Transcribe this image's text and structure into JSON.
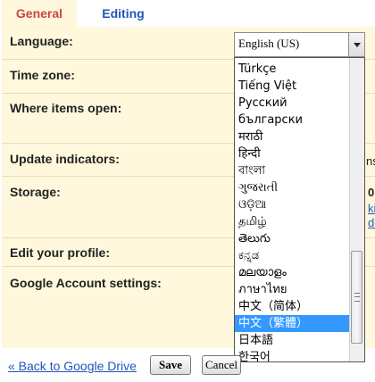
{
  "tabs": {
    "general": "General",
    "editing": "Editing"
  },
  "settings": {
    "language_label": "Language:",
    "time_zone_label": "Time zone:",
    "where_items_open_label": "Where items open:",
    "update_indicators_label": "Update indicators:",
    "storage_label": "Storage:",
    "edit_profile_label": "Edit your profile:",
    "google_account_label": "Google Account settings:"
  },
  "partial_text": {
    "update_suffix": "ns",
    "storage_suffix": "0",
    "storage_link_1": "ki",
    "storage_link_2": "de"
  },
  "language_select": {
    "selected_value": "English (US)"
  },
  "language_options": [
    "Türkçe",
    "Tiếng Việt",
    "Русский",
    "български",
    "मराठी",
    "हिन्दी",
    "বাংলা",
    "ગુજરાતી",
    "ଓଡ଼ିଆ",
    "தமிழ்",
    "తెలుగు",
    "ಕನ್ನಡ",
    "മലയാളം",
    "ภาษาไทย",
    "中文（简体）",
    "中文（繁體）",
    "日本語",
    "한국어"
  ],
  "highlighted_option": "中文（繁體）",
  "footer": {
    "back_link": "« Back to Google Drive",
    "save_button": "Save",
    "cancel_button": "Cancel"
  }
}
